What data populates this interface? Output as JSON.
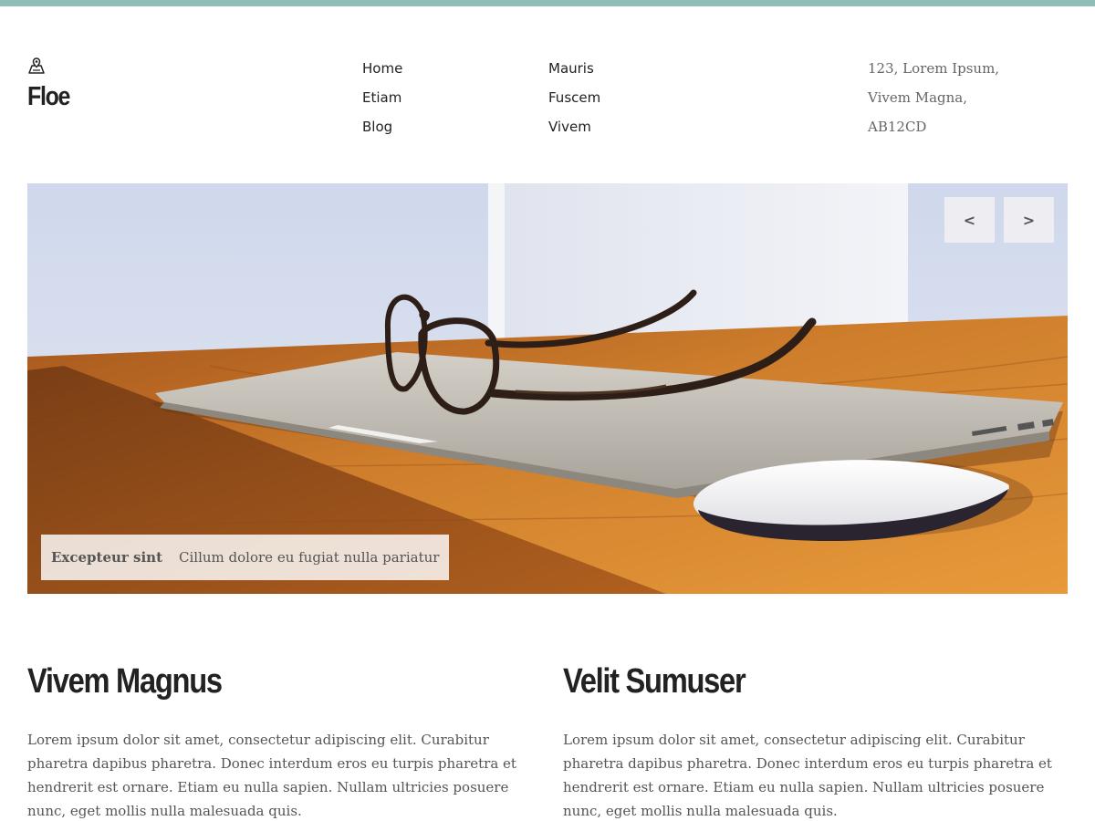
{
  "colors": {
    "accent_bar": "#8dbfb6",
    "heading": "#222222",
    "body_text": "#555555"
  },
  "brand": {
    "icon": "map-icon",
    "name": "Floe"
  },
  "nav": {
    "column_1": [
      {
        "label": "Home"
      },
      {
        "label": "Etiam"
      },
      {
        "label": "Blog"
      }
    ],
    "column_2": [
      {
        "label": "Mauris"
      },
      {
        "label": "Fuscem"
      },
      {
        "label": "Vivem"
      }
    ]
  },
  "address": {
    "lines": [
      "123, Lorem Ipsum,",
      "Vivem Magna,",
      "AB12CD"
    ]
  },
  "slider": {
    "image": "laptop-glasses-mouse-photo",
    "prev_label": "<",
    "next_label": ">",
    "caption": {
      "title": "Excepteur sint",
      "text": "Cillum dolore eu fugiat nulla pariatur"
    }
  },
  "columns": [
    {
      "heading": "Vivem Magnus",
      "body": "Lorem ipsum dolor sit amet, consectetur adipiscing elit. Curabitur pharetra dapibus pharetra. Donec interdum eros eu turpis pharetra et hendrerit est ornare. Etiam eu nulla sapien. Nullam ultricies posuere nunc, eget mollis nulla malesuada quis."
    },
    {
      "heading": "Velit Sumuser",
      "body": "Lorem ipsum dolor sit amet, consectetur adipiscing elit. Curabitur pharetra dapibus pharetra. Donec interdum eros eu turpis pharetra et hendrerit est ornare. Etiam eu nulla sapien. Nullam ultricies posuere nunc, eget mollis nulla malesuada quis."
    }
  ]
}
